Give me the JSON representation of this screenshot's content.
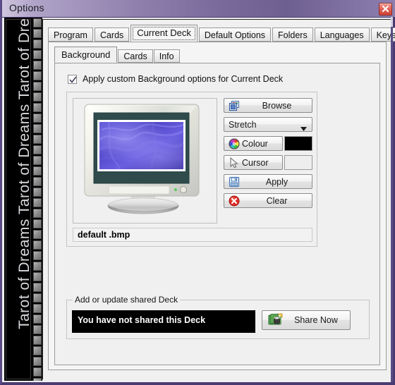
{
  "window": {
    "title": "Options",
    "close_icon": "close-x-icon"
  },
  "banner": {
    "text": "Tarot of Dreams Tarot of Dreams Tarot of Dreams Tarot of",
    "repeat_label": "Tarot of Dreams"
  },
  "primary_tabs": [
    {
      "label": "Program",
      "selected": false
    },
    {
      "label": "Cards",
      "selected": false
    },
    {
      "label": "Current Deck",
      "selected": true
    },
    {
      "label": "Default Options",
      "selected": false
    },
    {
      "label": "Folders",
      "selected": false
    },
    {
      "label": "Languages",
      "selected": false
    },
    {
      "label": "Keys",
      "selected": false
    }
  ],
  "secondary_tabs": [
    {
      "label": "Background",
      "selected": true
    },
    {
      "label": "Cards",
      "selected": false
    },
    {
      "label": "Info",
      "selected": false
    }
  ],
  "background_tab": {
    "apply_custom_checkbox": {
      "label": "Apply custom Background options for Current Deck",
      "checked": true,
      "check_icon": "checkmark-icon"
    },
    "preview": {
      "image_description": "blue purple silk wallpaper shown on CRT monitor",
      "monitor_icon": "crt-monitor-icon",
      "filename": "default .bmp"
    },
    "controls": {
      "browse_label": "Browse",
      "browse_icon": "copy-windows-icon",
      "mode_value": "Stretch",
      "mode_arrow_icon": "chevron-down-icon",
      "colour_label": "Colour",
      "colour_icon": "color-wheel-icon",
      "colour_value": "#000000",
      "cursor_label": "Cursor",
      "cursor_icon": "mouse-pointer-icon",
      "cursor_value": "#eeeeee",
      "apply_label": "Apply",
      "apply_icon": "floppy-save-icon",
      "clear_label": "Clear",
      "clear_icon": "red-cross-circle-icon"
    },
    "shared_deck": {
      "legend": "Add or update shared Deck",
      "status_text": "You have not shared this Deck",
      "share_button_label": "Share Now",
      "share_button_icon": "share-deck-icon"
    }
  },
  "colors": {
    "title_accent": "#7a6a9c",
    "window_border": "#4a3c72",
    "close_red": "#cf4236",
    "status_bg": "#000000",
    "panel_bg": "#f0f0f0"
  }
}
